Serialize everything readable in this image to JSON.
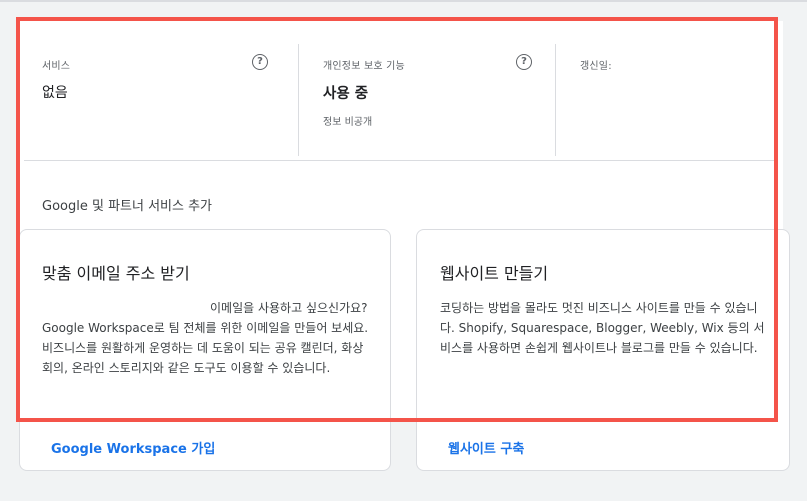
{
  "summary": {
    "service": {
      "label": "서비스",
      "value": "없음"
    },
    "privacy": {
      "label": "개인정보 보호 기능",
      "value": "사용 중",
      "sub": "정보 비공개"
    },
    "renewal": {
      "label": "갱신일:"
    },
    "help_icon": "help-circle-icon",
    "help_glyph": "?"
  },
  "section": {
    "title": "Google 및 파트너 서비스 추가"
  },
  "cards": [
    {
      "title": "맞춤 이메일 주소 받기",
      "text": "이메일을 사용하고 싶으신가요? Google Workspace로 팀 전체를 위한 이메일을 만들어 보세요. 비즈니스를 원활하게 운영하는 데 도움이 되는 공유 캘린더, 화상 회의, 온라인 스토리지와 같은 도구도 이용할 수 있습니다.",
      "link": "Google Workspace 가입"
    },
    {
      "title": "웹사이트 만들기",
      "text": "코딩하는 방법을 몰라도 멋진 비즈니스 사이트를 만들 수 있습니다. Shopify, Squarespace, Blogger, Weebly, Wix 등의 서비스를 사용하면 손쉽게 웹사이트나 블로그를 만들 수 있습니다.",
      "link": "웹사이트 구축"
    }
  ],
  "colors": {
    "highlight": "#f4544a",
    "link": "#1a73e8"
  }
}
